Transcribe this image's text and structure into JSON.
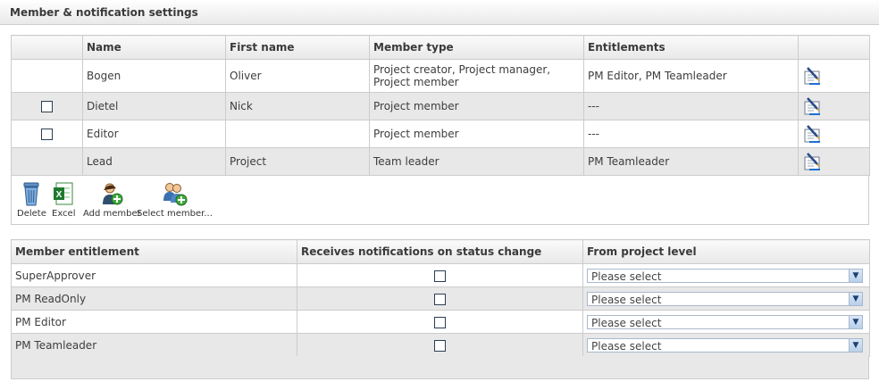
{
  "panel": {
    "title": "Member & notification settings"
  },
  "members": {
    "headers": {
      "name": "Name",
      "first_name": "First name",
      "member_type": "Member type",
      "entitlements": "Entitlements"
    },
    "rows": [
      {
        "name": "Bogen",
        "first_name": "Oliver",
        "member_type": "Project creator, Project manager, Project member",
        "entitlements": "PM Editor, PM Teamleader"
      },
      {
        "name": "Dietel",
        "first_name": "Nick",
        "member_type": "Project member",
        "entitlements": "---"
      },
      {
        "name": "Editor",
        "first_name": "",
        "member_type": "Project member",
        "entitlements": "---"
      },
      {
        "name": "Lead",
        "first_name": "Project",
        "member_type": "Team leader",
        "entitlements": "PM Teamleader"
      }
    ]
  },
  "toolbar": {
    "delete_label": "Delete",
    "excel_label": "Excel",
    "add_member_label": "Add member",
    "select_member_label": "Select member..."
  },
  "notifications": {
    "headers": {
      "entitlement": "Member entitlement",
      "receives": "Receives notifications on status change",
      "from_level": "From project level"
    },
    "rows": [
      {
        "entitlement": "SuperApprover",
        "level": "Please select"
      },
      {
        "entitlement": "PM ReadOnly",
        "level": "Please select"
      },
      {
        "entitlement": "PM Editor",
        "level": "Please select"
      },
      {
        "entitlement": "PM Teamleader",
        "level": "Please select"
      }
    ]
  },
  "icons": {
    "edit": "edit-notepad-icon",
    "delete": "trash-can-icon",
    "excel": "excel-icon",
    "add_member": "add-user-icon",
    "select_member": "select-users-icon",
    "dropdown": "chevron-down-icon"
  }
}
